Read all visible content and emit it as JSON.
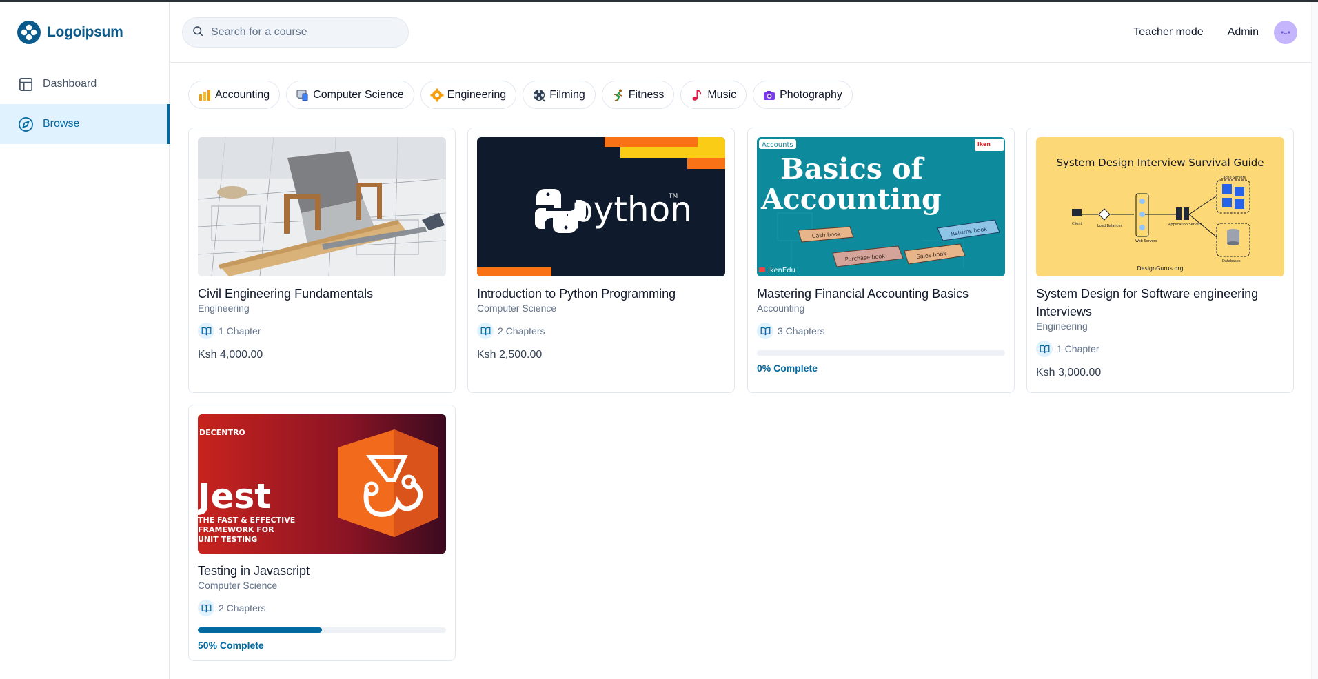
{
  "brand": {
    "name": "Logoipsum",
    "color": "#0b5a8c"
  },
  "sidebar": {
    "items": [
      {
        "label": "Dashboard",
        "icon": "layout-icon",
        "active": false
      },
      {
        "label": "Browse",
        "icon": "compass-icon",
        "active": true
      }
    ]
  },
  "header": {
    "search_placeholder": "Search for a course",
    "teacher_mode_label": "Teacher mode",
    "admin_label": "Admin"
  },
  "categories": [
    {
      "label": "Accounting",
      "icon": "bar-chart-icon"
    },
    {
      "label": "Computer Science",
      "icon": "computer-icon"
    },
    {
      "label": "Engineering",
      "icon": "gear-icon"
    },
    {
      "label": "Filming",
      "icon": "film-reel-icon"
    },
    {
      "label": "Fitness",
      "icon": "runner-icon"
    },
    {
      "label": "Music",
      "icon": "music-note-icon"
    },
    {
      "label": "Photography",
      "icon": "camera-icon"
    }
  ],
  "courses": [
    {
      "title": "Civil Engineering Fundamentals",
      "category": "Engineering",
      "chapters": "1 Chapter",
      "price": "Ksh 4,000.00",
      "thumb": "blueprint"
    },
    {
      "title": "Introduction to Python Programming",
      "category": "Computer Science",
      "chapters": "2 Chapters",
      "price": "Ksh 2,500.00",
      "thumb": "python"
    },
    {
      "title": "Mastering Financial Accounting Basics",
      "category": "Accounting",
      "chapters": "3 Chapters",
      "progress": 0,
      "progress_label": "0% Complete",
      "thumb": "accounting"
    },
    {
      "title": "System Design for Software engineering Interviews",
      "category": "Engineering",
      "chapters": "1 Chapter",
      "price": "Ksh 3,000.00",
      "thumb": "system-design"
    },
    {
      "title": "Testing in Javascript",
      "category": "Computer Science",
      "chapters": "2 Chapters",
      "progress": 50,
      "progress_label": "50% Complete",
      "thumb": "jest"
    }
  ],
  "thumbnails": {
    "python": {
      "text": "python",
      "tm": "TM"
    },
    "accounting": {
      "tag": "Accounts",
      "line1": "Basics of",
      "line2": "Accounting",
      "books": [
        "Cash book",
        "Purchase book",
        "Sales book",
        "Returns book"
      ],
      "channel": "IkenEdu",
      "badge": "iken"
    },
    "system_design": {
      "title": "System Design Interview Survival Guide",
      "labels": [
        "Client",
        "Load Balancer",
        "Web Servers",
        "Application Servers",
        "Cache Servers",
        "Databases"
      ],
      "footer": "DesignGurus.org"
    },
    "jest": {
      "brand": "DECENTRO",
      "title": "Jest",
      "tagline": [
        "THE FAST & EFFECTIVE",
        "FRAMEWORK FOR",
        "UNIT TESTING"
      ]
    }
  },
  "colors": {
    "accent": "#0369a1",
    "accent_light": "#e0f2fe"
  }
}
